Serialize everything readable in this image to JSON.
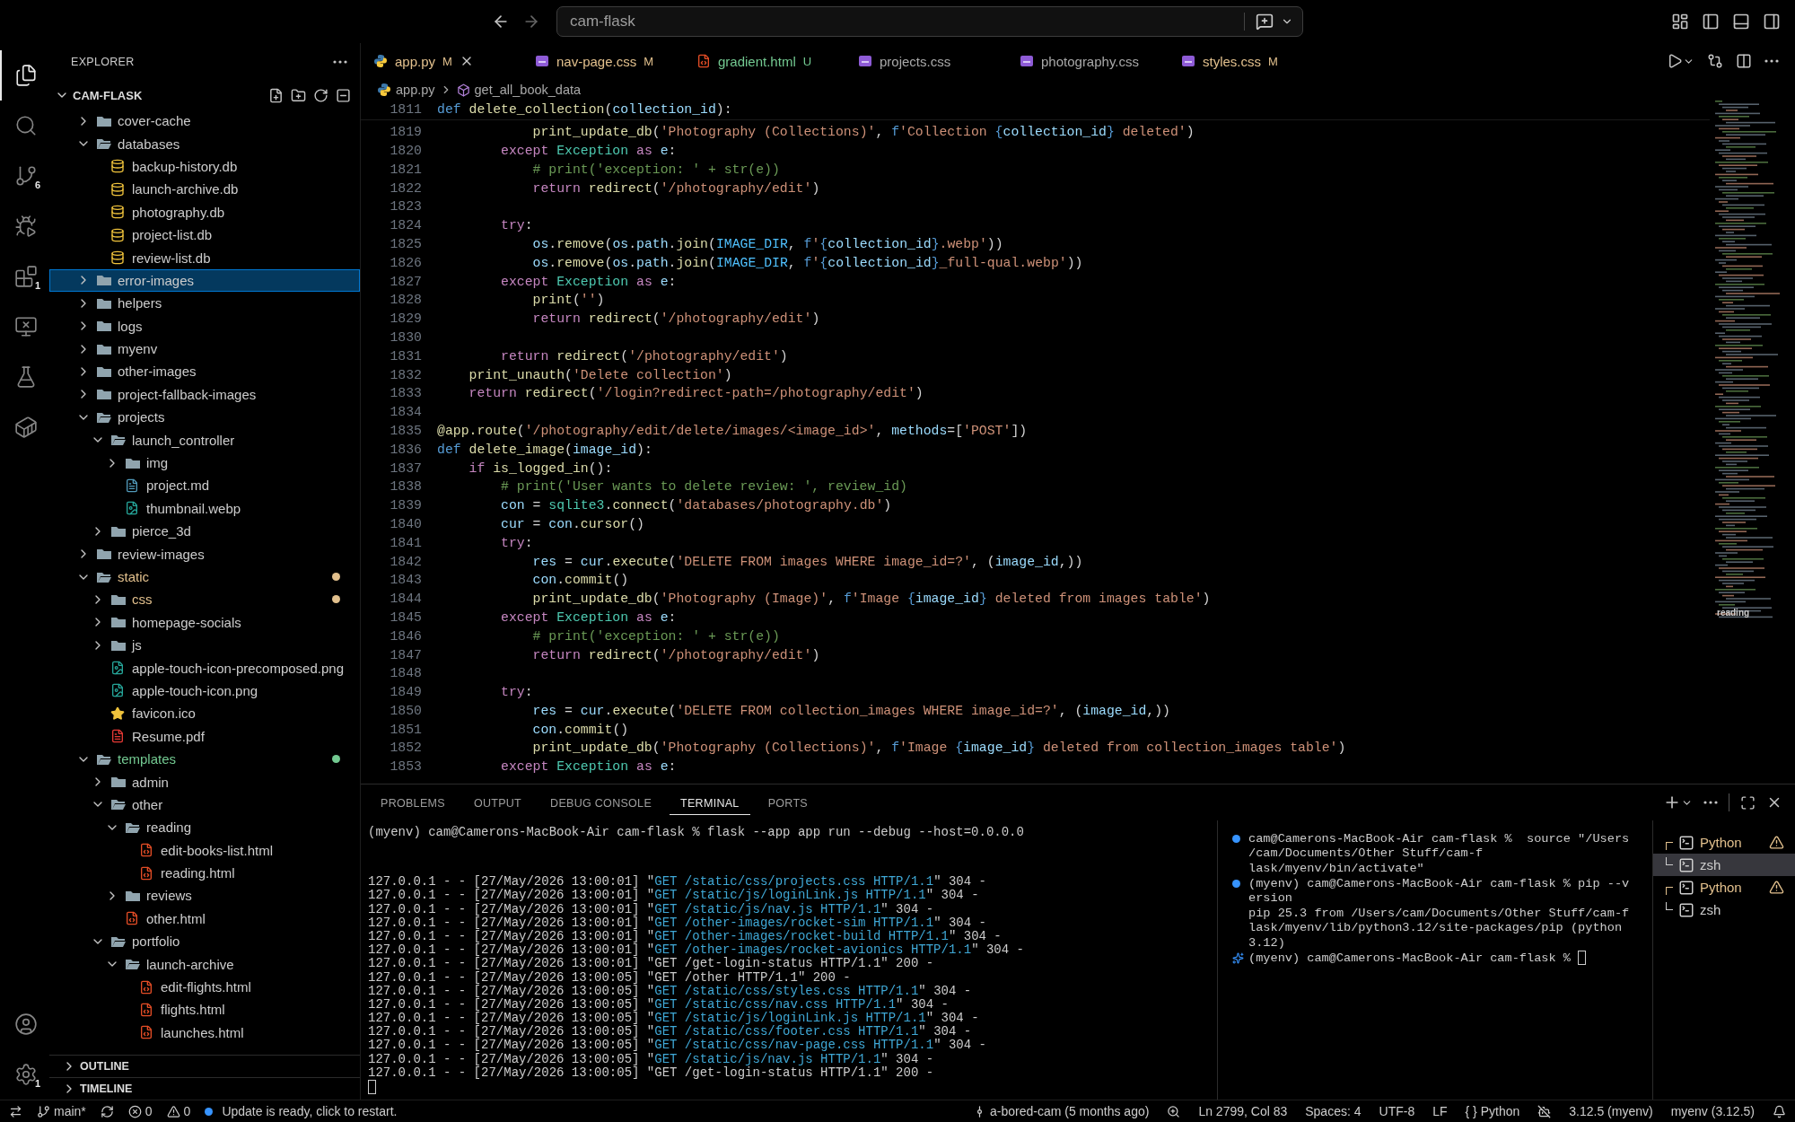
{
  "title_bar": {
    "search": {
      "value": "cam-flask"
    }
  },
  "activity_bar": {
    "top": [
      {
        "kind": "files",
        "selected": true
      },
      {
        "kind": "search",
        "selected": false
      },
      {
        "kind": "source-control",
        "selected": false,
        "badge": "6"
      },
      {
        "kind": "run-debug",
        "selected": false
      },
      {
        "kind": "extensions",
        "selected": false,
        "badge": "1"
      },
      {
        "kind": "remote",
        "selected": false
      },
      {
        "kind": "testing",
        "selected": false
      },
      {
        "kind": "containers",
        "selected": false
      }
    ],
    "bottom": [
      {
        "kind": "account",
        "selected": false
      },
      {
        "kind": "settings",
        "selected": false,
        "badge": "1"
      }
    ]
  },
  "explorer": {
    "title": "EXPLORER",
    "root": "CAM-FLASK",
    "tree": [
      {
        "label": "cover-cache",
        "kind": "folder",
        "expanded": false,
        "selected": false
      },
      {
        "label": "databases",
        "kind": "folder",
        "expanded": true,
        "selected": false,
        "children": [
          {
            "label": "backup-history.db",
            "kind": "db",
            "selected": false
          },
          {
            "label": "launch-archive.db",
            "kind": "db",
            "selected": false
          },
          {
            "label": "photography.db",
            "kind": "db",
            "selected": false
          },
          {
            "label": "project-list.db",
            "kind": "db",
            "selected": false
          },
          {
            "label": "review-list.db",
            "kind": "db",
            "selected": false
          }
        ]
      },
      {
        "label": "error-images",
        "kind": "folder",
        "expanded": false,
        "selected": true
      },
      {
        "label": "helpers",
        "kind": "folder",
        "expanded": false,
        "selected": false
      },
      {
        "label": "logs",
        "kind": "folder",
        "expanded": false,
        "selected": false
      },
      {
        "label": "myenv",
        "kind": "folder",
        "expanded": false,
        "selected": false
      },
      {
        "label": "other-images",
        "kind": "folder",
        "expanded": false,
        "selected": false
      },
      {
        "label": "project-fallback-images",
        "kind": "folder",
        "expanded": false,
        "selected": false
      },
      {
        "label": "projects",
        "kind": "folder",
        "expanded": true,
        "selected": false,
        "children": [
          {
            "label": "launch_controller",
            "kind": "folder",
            "expanded": true,
            "selected": false,
            "children": [
              {
                "label": "img",
                "kind": "folder",
                "expanded": false,
                "selected": false
              },
              {
                "label": "project.md",
                "kind": "markdown",
                "selected": false
              },
              {
                "label": "thumbnail.webp",
                "kind": "image",
                "selected": false
              }
            ]
          },
          {
            "label": "pierce_3d",
            "kind": "folder",
            "expanded": false,
            "selected": false
          }
        ]
      },
      {
        "label": "review-images",
        "kind": "folder",
        "expanded": false,
        "selected": false
      },
      {
        "label": "static",
        "kind": "folder",
        "expanded": true,
        "selected": false,
        "color": "#e2c08d",
        "children": [
          {
            "label": "css",
            "kind": "folder",
            "expanded": false,
            "selected": false,
            "color": "#e2c08d"
          },
          {
            "label": "homepage-socials",
            "kind": "folder",
            "expanded": false,
            "selected": false
          },
          {
            "label": "js",
            "kind": "folder",
            "expanded": false,
            "selected": false
          },
          {
            "label": "apple-touch-icon-precomposed.png",
            "kind": "image",
            "selected": false
          },
          {
            "label": "apple-touch-icon.png",
            "kind": "image",
            "selected": false
          },
          {
            "label": "favicon.ico",
            "kind": "star",
            "selected": false
          },
          {
            "label": "Resume.pdf",
            "kind": "pdf",
            "selected": false
          }
        ]
      },
      {
        "label": "templates",
        "kind": "folder",
        "expanded": true,
        "selected": false,
        "color": "#73c991",
        "children": [
          {
            "label": "admin",
            "kind": "folder",
            "expanded": false,
            "selected": false
          },
          {
            "label": "other",
            "kind": "folder",
            "expanded": true,
            "selected": false,
            "children": [
              {
                "label": "reading",
                "kind": "folder",
                "expanded": true,
                "selected": false,
                "children": [
                  {
                    "label": "edit-books-list.html",
                    "kind": "html",
                    "selected": false
                  },
                  {
                    "label": "reading.html",
                    "kind": "html",
                    "selected": false
                  }
                ]
              },
              {
                "label": "reviews",
                "kind": "folder",
                "expanded": false,
                "selected": false
              },
              {
                "label": "other.html",
                "kind": "html",
                "selected": false
              }
            ]
          },
          {
            "label": "portfolio",
            "kind": "folder",
            "expanded": true,
            "selected": false,
            "children": [
              {
                "label": "launch-archive",
                "kind": "folder",
                "expanded": true,
                "selected": false,
                "children": [
                  {
                    "label": "edit-flights.html",
                    "kind": "html",
                    "selected": false
                  },
                  {
                    "label": "flights.html",
                    "kind": "html",
                    "selected": false
                  },
                  {
                    "label": "launches.html",
                    "kind": "html",
                    "selected": false
                  }
                ]
              }
            ]
          }
        ]
      }
    ],
    "sections": [
      {
        "label": "OUTLINE",
        "expanded": false
      },
      {
        "label": "TIMELINE",
        "expanded": false
      }
    ]
  },
  "tabs": [
    {
      "label": "app.py",
      "kind": "python",
      "status": "M",
      "selected": true
    },
    {
      "label": "nav-page.css",
      "kind": "css",
      "status": "M",
      "selected": false
    },
    {
      "label": "gradient.html",
      "kind": "html",
      "status": "U",
      "selected": false
    },
    {
      "label": "projects.css",
      "kind": "css",
      "selected": false
    },
    {
      "label": "photography.css",
      "kind": "css",
      "selected": false
    },
    {
      "label": "styles.css",
      "kind": "css",
      "status": "M",
      "selected": false
    }
  ],
  "breadcrumbs": [
    {
      "label": "app.py",
      "kind": "python"
    },
    {
      "label": "get_all_book_data",
      "kind": "symbol"
    }
  ],
  "editor": {
    "sticky": {
      "number": "1811",
      "tokens": [
        {
          "kind": "storage",
          "text": "def "
        },
        {
          "kind": "function",
          "text": "delete_collection"
        },
        {
          "kind": "plain",
          "text": "("
        },
        {
          "kind": "variable",
          "text": "collection_id"
        },
        {
          "kind": "plain",
          "text": "):"
        }
      ]
    },
    "lines": [
      {
        "number": "1819",
        "tokens": [
          {
            "kind": "function",
            "text": "            print_update_db"
          },
          {
            "kind": "plain",
            "text": "("
          },
          {
            "kind": "string",
            "text": "'Photography (Collections)'"
          },
          {
            "kind": "plain",
            "text": ", "
          },
          {
            "kind": "storage",
            "text": "f"
          },
          {
            "kind": "string",
            "text": "'Collection "
          },
          {
            "kind": "storage",
            "text": "{"
          },
          {
            "kind": "variable",
            "text": "collection_id"
          },
          {
            "kind": "storage",
            "text": "}"
          },
          {
            "kind": "string",
            "text": " deleted'"
          },
          {
            "kind": "plain",
            "text": ")"
          }
        ]
      },
      {
        "number": "1820",
        "tokens": [
          {
            "kind": "keyword",
            "text": "        except "
          },
          {
            "kind": "type",
            "text": "Exception "
          },
          {
            "kind": "keyword",
            "text": "as "
          },
          {
            "kind": "variable",
            "text": "e"
          },
          {
            "kind": "plain",
            "text": ":"
          }
        ]
      },
      {
        "number": "1821",
        "tokens": [
          {
            "kind": "comment",
            "text": "            # print('exception: ' + str(e))"
          }
        ]
      },
      {
        "number": "1822",
        "tokens": [
          {
            "kind": "keyword",
            "text": "            return "
          },
          {
            "kind": "function",
            "text": "redirect"
          },
          {
            "kind": "plain",
            "text": "("
          },
          {
            "kind": "string",
            "text": "'/photography/edit'"
          },
          {
            "kind": "plain",
            "text": ")"
          }
        ]
      },
      {
        "number": "1823"
      },
      {
        "number": "1824",
        "tokens": [
          {
            "kind": "keyword",
            "text": "        try"
          },
          {
            "kind": "plain",
            "text": ":"
          }
        ]
      },
      {
        "number": "1825",
        "tokens": [
          {
            "kind": "variable",
            "text": "            os"
          },
          {
            "kind": "plain",
            "text": "."
          },
          {
            "kind": "function",
            "text": "remove"
          },
          {
            "kind": "plain",
            "text": "("
          },
          {
            "kind": "variable",
            "text": "os"
          },
          {
            "kind": "plain",
            "text": "."
          },
          {
            "kind": "variable",
            "text": "path"
          },
          {
            "kind": "plain",
            "text": "."
          },
          {
            "kind": "function",
            "text": "join"
          },
          {
            "kind": "plain",
            "text": "("
          },
          {
            "kind": "constant",
            "text": "IMAGE_DIR"
          },
          {
            "kind": "plain",
            "text": ", "
          },
          {
            "kind": "storage",
            "text": "f"
          },
          {
            "kind": "string",
            "text": "'"
          },
          {
            "kind": "storage",
            "text": "{"
          },
          {
            "kind": "variable",
            "text": "collection_id"
          },
          {
            "kind": "storage",
            "text": "}"
          },
          {
            "kind": "string",
            "text": ".webp'"
          },
          {
            "kind": "plain",
            "text": "))"
          }
        ]
      },
      {
        "number": "1826",
        "tokens": [
          {
            "kind": "variable",
            "text": "            os"
          },
          {
            "kind": "plain",
            "text": "."
          },
          {
            "kind": "function",
            "text": "remove"
          },
          {
            "kind": "plain",
            "text": "("
          },
          {
            "kind": "variable",
            "text": "os"
          },
          {
            "kind": "plain",
            "text": "."
          },
          {
            "kind": "variable",
            "text": "path"
          },
          {
            "kind": "plain",
            "text": "."
          },
          {
            "kind": "function",
            "text": "join"
          },
          {
            "kind": "plain",
            "text": "("
          },
          {
            "kind": "constant",
            "text": "IMAGE_DIR"
          },
          {
            "kind": "plain",
            "text": ", "
          },
          {
            "kind": "storage",
            "text": "f"
          },
          {
            "kind": "string",
            "text": "'"
          },
          {
            "kind": "storage",
            "text": "{"
          },
          {
            "kind": "variable",
            "text": "collection_id"
          },
          {
            "kind": "storage",
            "text": "}"
          },
          {
            "kind": "string",
            "text": "_full-qual.webp'"
          },
          {
            "kind": "plain",
            "text": "))"
          }
        ]
      },
      {
        "number": "1827",
        "tokens": [
          {
            "kind": "keyword",
            "text": "        except "
          },
          {
            "kind": "type",
            "text": "Exception "
          },
          {
            "kind": "keyword",
            "text": "as "
          },
          {
            "kind": "variable",
            "text": "e"
          },
          {
            "kind": "plain",
            "text": ":"
          }
        ]
      },
      {
        "number": "1828",
        "tokens": [
          {
            "kind": "function",
            "text": "            print"
          },
          {
            "kind": "plain",
            "text": "("
          },
          {
            "kind": "string",
            "text": "''"
          },
          {
            "kind": "plain",
            "text": ")"
          }
        ]
      },
      {
        "number": "1829",
        "tokens": [
          {
            "kind": "keyword",
            "text": "            return "
          },
          {
            "kind": "function",
            "text": "redirect"
          },
          {
            "kind": "plain",
            "text": "("
          },
          {
            "kind": "string",
            "text": "'/photography/edit'"
          },
          {
            "kind": "plain",
            "text": ")"
          }
        ]
      },
      {
        "number": "1830"
      },
      {
        "number": "1831",
        "tokens": [
          {
            "kind": "keyword",
            "text": "        return "
          },
          {
            "kind": "function",
            "text": "redirect"
          },
          {
            "kind": "plain",
            "text": "("
          },
          {
            "kind": "string",
            "text": "'/photography/edit'"
          },
          {
            "kind": "plain",
            "text": ")"
          }
        ]
      },
      {
        "number": "1832",
        "tokens": [
          {
            "kind": "function",
            "text": "    print_unauth"
          },
          {
            "kind": "plain",
            "text": "("
          },
          {
            "kind": "string",
            "text": "'Delete collection'"
          },
          {
            "kind": "plain",
            "text": ")"
          }
        ]
      },
      {
        "number": "1833",
        "tokens": [
          {
            "kind": "keyword",
            "text": "    return "
          },
          {
            "kind": "function",
            "text": "redirect"
          },
          {
            "kind": "plain",
            "text": "("
          },
          {
            "kind": "string",
            "text": "'/login?redirect-path=/photography/edit'"
          },
          {
            "kind": "plain",
            "text": ")"
          }
        ]
      },
      {
        "number": "1834"
      },
      {
        "number": "1835",
        "tokens": [
          {
            "kind": "function",
            "text": "@app.route"
          },
          {
            "kind": "plain",
            "text": "("
          },
          {
            "kind": "string",
            "text": "'/photography/edit/delete/images/<image_id>'"
          },
          {
            "kind": "plain",
            "text": ", "
          },
          {
            "kind": "variable",
            "text": "methods"
          },
          {
            "kind": "plain",
            "text": "=["
          },
          {
            "kind": "string",
            "text": "'POST'"
          },
          {
            "kind": "plain",
            "text": "])"
          }
        ]
      },
      {
        "number": "1836",
        "tokens": [
          {
            "kind": "storage",
            "text": "def "
          },
          {
            "kind": "function",
            "text": "delete_image"
          },
          {
            "kind": "plain",
            "text": "("
          },
          {
            "kind": "variable",
            "text": "image_id"
          },
          {
            "kind": "plain",
            "text": "):"
          }
        ]
      },
      {
        "number": "1837",
        "tokens": [
          {
            "kind": "keyword",
            "text": "    if "
          },
          {
            "kind": "function",
            "text": "is_logged_in"
          },
          {
            "kind": "plain",
            "text": "():"
          }
        ]
      },
      {
        "number": "1838",
        "tokens": [
          {
            "kind": "comment",
            "text": "        # print('User wants to delete review: ', review_id)"
          }
        ]
      },
      {
        "number": "1839",
        "tokens": [
          {
            "kind": "variable",
            "text": "        con"
          },
          {
            "kind": "plain",
            "text": " = "
          },
          {
            "kind": "type",
            "text": "sqlite3"
          },
          {
            "kind": "plain",
            "text": "."
          },
          {
            "kind": "function",
            "text": "connect"
          },
          {
            "kind": "plain",
            "text": "("
          },
          {
            "kind": "string",
            "text": "'databases/photography.db'"
          },
          {
            "kind": "plain",
            "text": ")"
          }
        ]
      },
      {
        "number": "1840",
        "tokens": [
          {
            "kind": "variable",
            "text": "        cur"
          },
          {
            "kind": "plain",
            "text": " = "
          },
          {
            "kind": "variable",
            "text": "con"
          },
          {
            "kind": "plain",
            "text": "."
          },
          {
            "kind": "function",
            "text": "cursor"
          },
          {
            "kind": "plain",
            "text": "()"
          }
        ]
      },
      {
        "number": "1841",
        "tokens": [
          {
            "kind": "keyword",
            "text": "        try"
          },
          {
            "kind": "plain",
            "text": ":"
          }
        ]
      },
      {
        "number": "1842",
        "tokens": [
          {
            "kind": "variable",
            "text": "            res"
          },
          {
            "kind": "plain",
            "text": " = "
          },
          {
            "kind": "variable",
            "text": "cur"
          },
          {
            "kind": "plain",
            "text": "."
          },
          {
            "kind": "function",
            "text": "execute"
          },
          {
            "kind": "plain",
            "text": "("
          },
          {
            "kind": "string",
            "text": "'DELETE FROM images WHERE image_id=?'"
          },
          {
            "kind": "plain",
            "text": ", ("
          },
          {
            "kind": "variable",
            "text": "image_id"
          },
          {
            "kind": "plain",
            "text": ",))"
          }
        ]
      },
      {
        "number": "1843",
        "tokens": [
          {
            "kind": "variable",
            "text": "            con"
          },
          {
            "kind": "plain",
            "text": "."
          },
          {
            "kind": "function",
            "text": "commit"
          },
          {
            "kind": "plain",
            "text": "()"
          }
        ]
      },
      {
        "number": "1844",
        "tokens": [
          {
            "kind": "function",
            "text": "            print_update_db"
          },
          {
            "kind": "plain",
            "text": "("
          },
          {
            "kind": "string",
            "text": "'Photography (Image)'"
          },
          {
            "kind": "plain",
            "text": ", "
          },
          {
            "kind": "storage",
            "text": "f"
          },
          {
            "kind": "string",
            "text": "'Image "
          },
          {
            "kind": "storage",
            "text": "{"
          },
          {
            "kind": "variable",
            "text": "image_id"
          },
          {
            "kind": "storage",
            "text": "}"
          },
          {
            "kind": "string",
            "text": " deleted from images table'"
          },
          {
            "kind": "plain",
            "text": ")"
          }
        ]
      },
      {
        "number": "1845",
        "tokens": [
          {
            "kind": "keyword",
            "text": "        except "
          },
          {
            "kind": "type",
            "text": "Exception "
          },
          {
            "kind": "keyword",
            "text": "as "
          },
          {
            "kind": "variable",
            "text": "e"
          },
          {
            "kind": "plain",
            "text": ":"
          }
        ]
      },
      {
        "number": "1846",
        "tokens": [
          {
            "kind": "comment",
            "text": "            # print('exception: ' + str(e))"
          }
        ]
      },
      {
        "number": "1847",
        "tokens": [
          {
            "kind": "keyword",
            "text": "            return "
          },
          {
            "kind": "function",
            "text": "redirect"
          },
          {
            "kind": "plain",
            "text": "("
          },
          {
            "kind": "string",
            "text": "'/photography/edit'"
          },
          {
            "kind": "plain",
            "text": ")"
          }
        ]
      },
      {
        "number": "1848"
      },
      {
        "number": "1849",
        "tokens": [
          {
            "kind": "keyword",
            "text": "        try"
          },
          {
            "kind": "plain",
            "text": ":"
          }
        ]
      },
      {
        "number": "1850",
        "tokens": [
          {
            "kind": "variable",
            "text": "            res"
          },
          {
            "kind": "plain",
            "text": " = "
          },
          {
            "kind": "variable",
            "text": "cur"
          },
          {
            "kind": "plain",
            "text": "."
          },
          {
            "kind": "function",
            "text": "execute"
          },
          {
            "kind": "plain",
            "text": "("
          },
          {
            "kind": "string",
            "text": "'DELETE FROM collection_images WHERE image_id=?'"
          },
          {
            "kind": "plain",
            "text": ", ("
          },
          {
            "kind": "variable",
            "text": "image_id"
          },
          {
            "kind": "plain",
            "text": ",))"
          }
        ]
      },
      {
        "number": "1851",
        "tokens": [
          {
            "kind": "variable",
            "text": "            con"
          },
          {
            "kind": "plain",
            "text": "."
          },
          {
            "kind": "function",
            "text": "commit"
          },
          {
            "kind": "plain",
            "text": "()"
          }
        ]
      },
      {
        "number": "1852",
        "tokens": [
          {
            "kind": "function",
            "text": "            print_update_db"
          },
          {
            "kind": "plain",
            "text": "("
          },
          {
            "kind": "string",
            "text": "'Photography (Collections)'"
          },
          {
            "kind": "plain",
            "text": ", "
          },
          {
            "kind": "storage",
            "text": "f"
          },
          {
            "kind": "string",
            "text": "'Image "
          },
          {
            "kind": "storage",
            "text": "{"
          },
          {
            "kind": "variable",
            "text": "image_id"
          },
          {
            "kind": "storage",
            "text": "}"
          },
          {
            "kind": "string",
            "text": " deleted from collection_images table'"
          },
          {
            "kind": "plain",
            "text": ")"
          }
        ]
      },
      {
        "number": "1853",
        "tokens": [
          {
            "kind": "keyword",
            "text": "        except "
          },
          {
            "kind": "type",
            "text": "Exception "
          },
          {
            "kind": "keyword",
            "text": "as "
          },
          {
            "kind": "variable",
            "text": "e"
          },
          {
            "kind": "plain",
            "text": ":"
          }
        ]
      }
    ],
    "minimap_marker": "reading"
  },
  "panel": {
    "tabs": [
      {
        "label": "PROBLEMS",
        "selected": false
      },
      {
        "label": "OUTPUT",
        "selected": false
      },
      {
        "label": "DEBUG CONSOLE",
        "selected": false
      },
      {
        "label": "TERMINAL",
        "selected": true
      },
      {
        "label": "PORTS",
        "selected": false
      }
    ],
    "terminal_left": {
      "command": "(myenv) cam@Camerons-MacBook-Air cam-flask % flask --app app run --debug --host=0.0.0.0",
      "log": [
        {
          "prefix": "127.0.0.1 - - [27/May/2026 13:00:01] \"",
          "request": "GET /static/css/projects.css HTTP/1.1",
          "suffix": "\" 304 -",
          "highlight": true
        },
        {
          "prefix": "127.0.0.1 - - [27/May/2026 13:00:01] \"",
          "request": "GET /static/js/loginLink.js HTTP/1.1",
          "suffix": "\" 304 -",
          "highlight": true
        },
        {
          "prefix": "127.0.0.1 - - [27/May/2026 13:00:01] \"",
          "request": "GET /static/js/nav.js HTTP/1.1",
          "suffix": "\" 304 -",
          "highlight": true
        },
        {
          "prefix": "127.0.0.1 - - [27/May/2026 13:00:01] \"",
          "request": "GET /other-images/rocket-sim HTTP/1.1",
          "suffix": "\" 304 -",
          "highlight": true
        },
        {
          "prefix": "127.0.0.1 - - [27/May/2026 13:00:01] \"",
          "request": "GET /other-images/rocket-build HTTP/1.1",
          "suffix": "\" 304 -",
          "highlight": true
        },
        {
          "prefix": "127.0.0.1 - - [27/May/2026 13:00:01] \"",
          "request": "GET /other-images/rocket-avionics HTTP/1.1",
          "suffix": "\" 304 -",
          "highlight": true
        },
        {
          "prefix": "127.0.0.1 - - [27/May/2026 13:00:01] \"",
          "request": "GET /get-login-status HTTP/1.1",
          "suffix": "\" 200 -",
          "highlight": false
        },
        {
          "prefix": "127.0.0.1 - - [27/May/2026 13:00:05] \"",
          "request": "GET /other HTTP/1.1",
          "suffix": "\" 200 -",
          "highlight": false
        },
        {
          "prefix": "127.0.0.1 - - [27/May/2026 13:00:05] \"",
          "request": "GET /static/css/styles.css HTTP/1.1",
          "suffix": "\" 304 -",
          "highlight": true
        },
        {
          "prefix": "127.0.0.1 - - [27/May/2026 13:00:05] \"",
          "request": "GET /static/css/nav.css HTTP/1.1",
          "suffix": "\" 304 -",
          "highlight": true
        },
        {
          "prefix": "127.0.0.1 - - [27/May/2026 13:00:05] \"",
          "request": "GET /static/js/loginLink.js HTTP/1.1",
          "suffix": "\" 304 -",
          "highlight": true
        },
        {
          "prefix": "127.0.0.1 - - [27/May/2026 13:00:05] \"",
          "request": "GET /static/css/footer.css HTTP/1.1",
          "suffix": "\" 304 -",
          "highlight": true
        },
        {
          "prefix": "127.0.0.1 - - [27/May/2026 13:00:05] \"",
          "request": "GET /static/css/nav-page.css HTTP/1.1",
          "suffix": "\" 304 -",
          "highlight": true
        },
        {
          "prefix": "127.0.0.1 - - [27/May/2026 13:00:05] \"",
          "request": "GET /static/js/nav.js HTTP/1.1",
          "suffix": "\" 304 -",
          "highlight": true
        },
        {
          "prefix": "127.0.0.1 - - [27/May/2026 13:00:05] \"",
          "request": "GET /get-login-status HTTP/1.1",
          "suffix": "\" 200 -",
          "highlight": false
        }
      ]
    },
    "terminal_right": [
      {
        "kind": "success",
        "text": "cam@Camerons-MacBook-Air cam-flask %  source \"/Users"
      },
      {
        "kind": "plain",
        "text": "/cam/Documents/Other Stuff/cam-f"
      },
      {
        "kind": "plain",
        "text": "lask/myenv/bin/activate\""
      },
      {
        "kind": "success",
        "text": "(myenv) cam@Camerons-MacBook-Air cam-flask % pip --v"
      },
      {
        "kind": "plain",
        "text": "ersion"
      },
      {
        "kind": "plain",
        "text": "pip 25.3 from /Users/cam/Documents/Other Stuff/cam-f"
      },
      {
        "kind": "plain",
        "text": "lask/myenv/lib/python3.12/site-packages/pip (python"
      },
      {
        "kind": "plain",
        "text": "3.12)"
      },
      {
        "kind": "prompt",
        "text": "(myenv) cam@Camerons-MacBook-Air cam-flask % "
      }
    ],
    "terminals": [
      {
        "label": "Python",
        "warning": true,
        "selected": false,
        "children": [
          {
            "label": "zsh",
            "warning": false,
            "selected": true
          }
        ]
      },
      {
        "label": "Python",
        "warning": true,
        "selected": false,
        "children": [
          {
            "label": "zsh",
            "warning": false,
            "selected": false
          }
        ]
      }
    ]
  },
  "status_bar": {
    "left": [
      {
        "kind": "remote"
      },
      {
        "kind": "branch",
        "text": "main*"
      },
      {
        "kind": "sync"
      },
      {
        "kind": "errors",
        "text": "0"
      },
      {
        "kind": "warnings",
        "text": "0"
      },
      {
        "kind": "update",
        "text": "Update is ready, click to restart."
      }
    ],
    "right": [
      {
        "kind": "blame",
        "text": "a-bored-cam (5 months ago)"
      },
      {
        "kind": "zoom"
      },
      {
        "kind": "text",
        "text": "Ln 2799, Col 83"
      },
      {
        "kind": "text",
        "text": "Spaces: 4"
      },
      {
        "kind": "text",
        "text": "UTF-8"
      },
      {
        "kind": "text",
        "text": "LF"
      },
      {
        "kind": "text",
        "text": "{ } Python"
      },
      {
        "kind": "copilot"
      },
      {
        "kind": "text",
        "text": "3.12.5 (myenv)"
      },
      {
        "kind": "text",
        "text": "myenv (3.12.5)"
      },
      {
        "kind": "bell"
      }
    ]
  }
}
